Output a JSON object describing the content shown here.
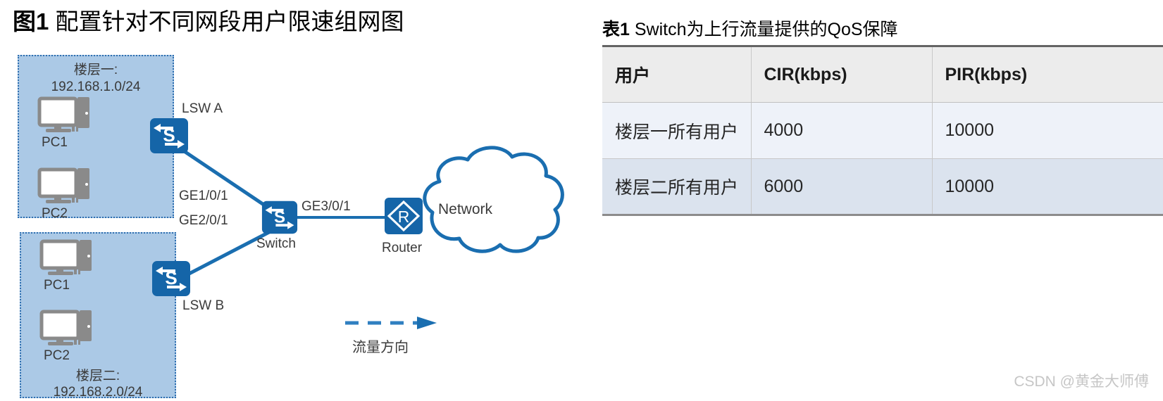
{
  "figure": {
    "caption_number": "图1",
    "caption_text": "配置针对不同网段用户限速组网图",
    "floors": [
      {
        "name_line": "楼层一:",
        "subnet_line": "192.168.1.0/24",
        "pcs": [
          "PC1",
          "PC2"
        ],
        "switch_label": "LSW A"
      },
      {
        "name_line": "楼层二:",
        "subnet_line": "192.168.2.0/24",
        "pcs": [
          "PC1",
          "PC2"
        ],
        "switch_label": "LSW B"
      }
    ],
    "core_switch_label": "Switch",
    "router_label": "Router",
    "cloud_label": "Network",
    "ports": {
      "uplink_floor1": "GE1/0/1",
      "uplink_floor2": "GE2/0/1",
      "uplink_router": "GE3/0/1"
    },
    "legend_label": "流量方向",
    "switch_icon_glyph": "S",
    "router_icon_glyph": "R"
  },
  "table": {
    "caption_number": "表1",
    "caption_text": "Switch为上行流量提供的QoS保障",
    "headers": [
      "用户",
      "CIR(kbps)",
      "PIR(kbps)"
    ],
    "rows": [
      [
        "楼层一所有用户",
        "4000",
        "10000"
      ],
      [
        "楼层二所有用户",
        "6000",
        "10000"
      ]
    ]
  },
  "watermark": "CSDN @黄金大师傅",
  "colors": {
    "device_blue": "#1565a8",
    "link_blue": "#1a6eb0",
    "floor_fill": "#abc9e6",
    "floor_border": "#2f6fb0",
    "table_header_bg": "#ececec",
    "table_row_even_bg": "#eef2f9",
    "table_row_odd_bg": "#dbe3ee"
  }
}
